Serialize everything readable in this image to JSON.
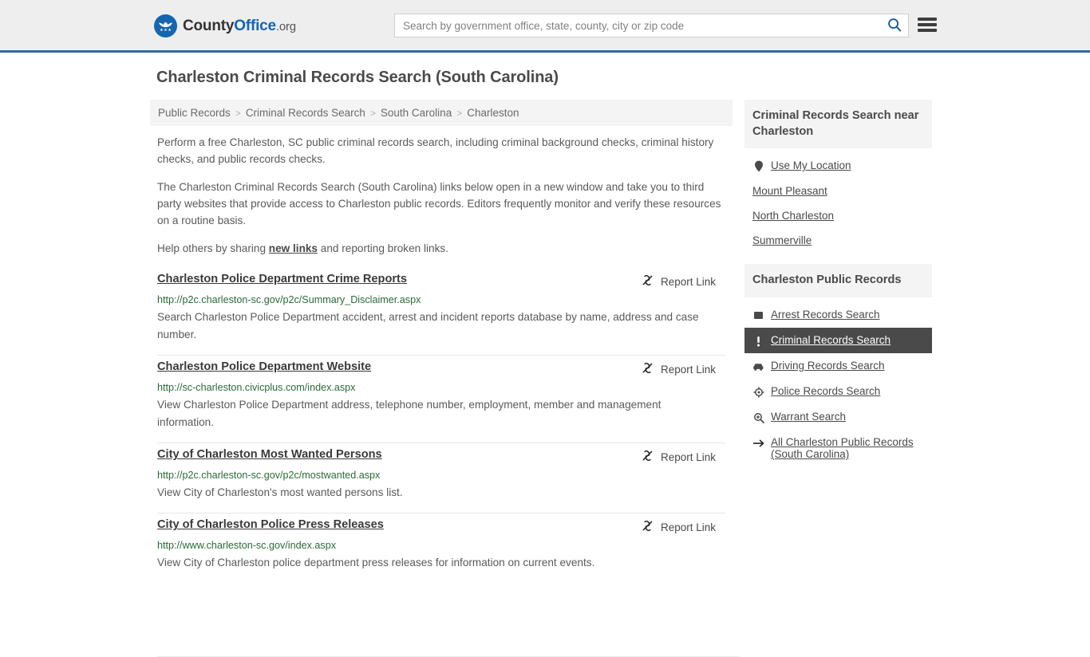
{
  "header": {
    "logo": {
      "part1": "County",
      "part2": "Office",
      "part3": ".org",
      "icon": "eagle-emblem-icon"
    },
    "search": {
      "placeholder": "Search by government office, state, county, city or zip code",
      "value": "",
      "search_icon": "search-icon"
    },
    "menu_icon": "hamburger-menu-icon",
    "accent_color": "#2b6ca3",
    "background_color": "#eeeeee"
  },
  "page": {
    "title": "Charleston Criminal Records Search (South Carolina)"
  },
  "breadcrumb": {
    "separator": ">",
    "items": [
      {
        "label": "Public Records"
      },
      {
        "label": "Criminal Records Search"
      },
      {
        "label": "South Carolina"
      },
      {
        "label": "Charleston"
      }
    ]
  },
  "intro": {
    "paragraph1": "Perform a free Charleston, SC public criminal records search, including criminal background checks, criminal history checks, and public records checks.",
    "paragraph2": "The Charleston Criminal Records Search (South Carolina) links below open in a new window and take you to third party websites that provide access to Charleston public records. Editors frequently monitor and verify these resources on a routine basis.",
    "paragraph3_before": "Help others by sharing ",
    "paragraph3_link": "new links",
    "paragraph3_after": " and reporting broken links."
  },
  "results": {
    "report_link_label": "Report Link",
    "report_link_icon": "broken-link-icon",
    "items": [
      {
        "title": "Charleston Police Department Crime Reports",
        "url": "http://p2c.charleston-sc.gov/p2c/Summary_Disclaimer.aspx",
        "description": "Search Charleston Police Department accident, arrest and incident reports database by name, address and case number."
      },
      {
        "title": "Charleston Police Department Website",
        "url": "http://sc-charleston.civicplus.com/index.aspx",
        "description": "View Charleston Police Department address, telephone number, employment, member and management information."
      },
      {
        "title": "City of Charleston Most Wanted Persons",
        "url": "http://p2c.charleston-sc.gov/p2c/mostwanted.aspx",
        "description": "View City of Charleston's most wanted persons list."
      },
      {
        "title": "City of Charleston Police Press Releases",
        "url": "http://www.charleston-sc.gov/index.aspx",
        "description": "View City of Charleston police department press releases for information on current events."
      }
    ]
  },
  "sidebar": {
    "nearby": {
      "heading": "Criminal Records Search near Charleston",
      "items": [
        {
          "label": "Use My Location",
          "icon": "map-pin-icon"
        },
        {
          "label": "Mount Pleasant",
          "icon": "none"
        },
        {
          "label": "North Charleston",
          "icon": "none"
        },
        {
          "label": "Summerville",
          "icon": "none"
        }
      ]
    },
    "public_records": {
      "heading": "Charleston Public Records",
      "active_background": "#4a4a4a",
      "items": [
        {
          "label": "Arrest Records Search",
          "icon": "square-icon",
          "active": false
        },
        {
          "label": "Criminal Records Search",
          "icon": "exclamation-icon",
          "active": true
        },
        {
          "label": "Driving Records Search",
          "icon": "car-icon",
          "active": false
        },
        {
          "label": "Police Records Search",
          "icon": "police-badge-icon",
          "active": false
        },
        {
          "label": "Warrant Search",
          "icon": "magnifier-plus-icon",
          "active": false
        },
        {
          "label": "All Charleston Public Records (South Carolina)",
          "icon": "arrow-right-icon",
          "active": false
        }
      ]
    }
  }
}
